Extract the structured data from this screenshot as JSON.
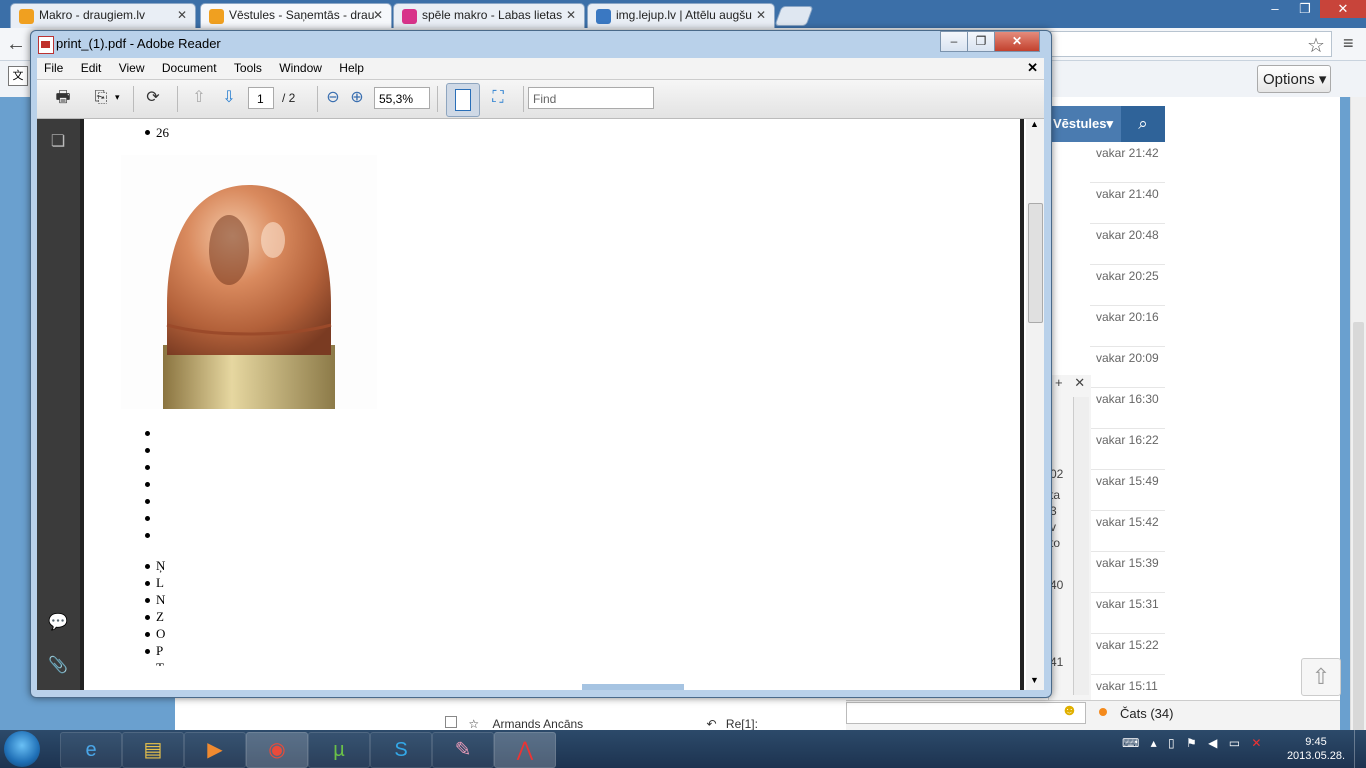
{
  "browser": {
    "tabs": [
      {
        "title": "Makro - draugiem.lv",
        "favicon_color": "#f0a020"
      },
      {
        "title": "Vēstules - Saņemtās - drau",
        "favicon_color": "#f0a020"
      },
      {
        "title": "spēle makro - Labas lietas",
        "favicon_color": "#d8338a"
      },
      {
        "title": "img.lejup.lv | Attēlu augšu",
        "favicon_color": "#3a78c2"
      }
    ],
    "options_label": "Options"
  },
  "webpage": {
    "messages_header": "Vēstules",
    "times": [
      "vakar 21:42",
      "vakar 21:40",
      "vakar 20:48",
      "vakar 20:25",
      "vakar 20:16",
      "vakar 20:09",
      "vakar 16:30",
      "vakar 16:22",
      "vakar 15:49",
      "vakar 15:42",
      "vakar 15:39",
      "vakar 15:31",
      "vakar 15:22",
      "vakar 15:11"
    ],
    "side_fragments": [
      "02",
      "ta",
      "3",
      "v",
      "to",
      "40",
      "41"
    ],
    "chat_label": "Čats (34)",
    "under_sender": "Armands Ancāns",
    "under_subject": "Re[1]:"
  },
  "reader": {
    "title": "print_(1).pdf - Adobe Reader",
    "menu": [
      "File",
      "Edit",
      "View",
      "Document",
      "Tools",
      "Window",
      "Help"
    ],
    "page_current": "1",
    "page_total": "/ 2",
    "zoom": "55,3%",
    "find_placeholder": "Find",
    "doc": {
      "first_item": "26",
      "letters": [
        "Ņ",
        "L",
        "N",
        "Z",
        "O",
        "P",
        "T"
      ]
    }
  },
  "taskbar": {
    "time": "9:45",
    "date": "2013.05.28."
  }
}
